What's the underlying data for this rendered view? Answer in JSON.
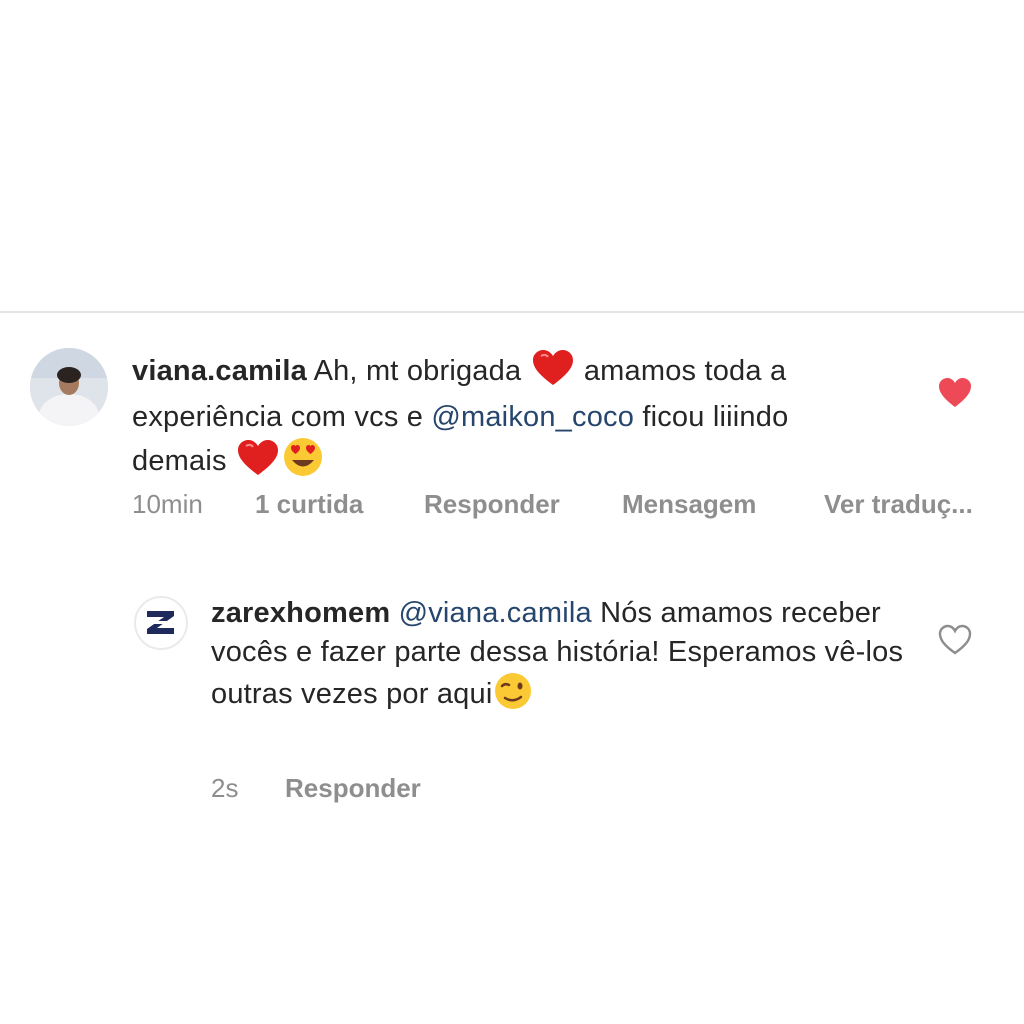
{
  "comments": [
    {
      "username": "viana.camila",
      "text_1": " Ah, mt obrigada ",
      "text_2": " amamos toda a experiência com vcs e ",
      "mention": "@maikon_coco",
      "text_3": " ficou liiindo demais ",
      "time": "10min",
      "likes": "1 curtida",
      "reply": "Responder",
      "message": "Mensagem",
      "translate": "Ver traduç...",
      "liked": true,
      "emojis": [
        "red-heart",
        "red-heart",
        "heart-eyes"
      ]
    },
    {
      "username": "zarexhomem",
      "mention": "@viana.camila",
      "text_1": " Nós amamos receber vocês e fazer parte dessa história! Esperamos vê-los outras vezes por aqui",
      "time": "2s",
      "reply": "Responder",
      "liked": false,
      "emojis": [
        "winking-face"
      ]
    }
  ],
  "colors": {
    "like_active": "#ed4956",
    "mention": "#27466d",
    "meta": "#8e8e8e"
  }
}
